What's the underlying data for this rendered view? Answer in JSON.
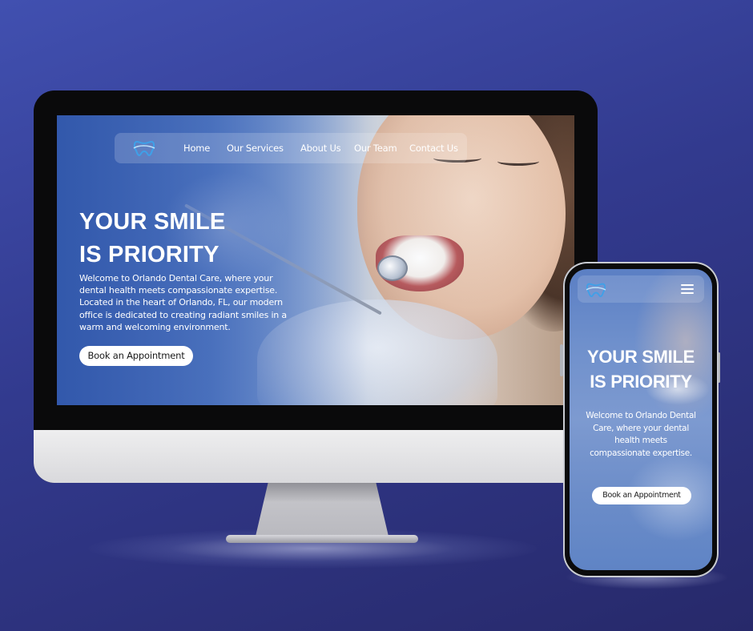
{
  "desktop": {
    "nav": {
      "items": [
        {
          "label": "Home"
        },
        {
          "label": "Our Services"
        },
        {
          "label": "About Us"
        },
        {
          "label": "Our Team"
        },
        {
          "label": "Contact Us"
        }
      ],
      "logo_icon": "tooth-logo-icon"
    },
    "hero": {
      "title_line1": "YOUR SMILE",
      "title_line2": "IS PRIORITY",
      "description": "Welcome to Orlando Dental Care, where your dental health meets compassionate expertise. Located in the heart of Orlando, FL, our modern office is dedicated to creating radiant smiles in a warm and welcoming environment.",
      "cta_label": "Book an Appointment"
    }
  },
  "mobile": {
    "nav": {
      "logo_icon": "tooth-logo-icon",
      "menu_icon": "hamburger-menu-icon"
    },
    "hero": {
      "title_line1": "YOUR SMILE",
      "title_line2": "IS PRIORITY",
      "description": "Welcome to Orlando Dental Care, where your dental health meets compassionate expertise.",
      "cta_label": "Book an Appointment"
    }
  },
  "colors": {
    "background": "#3a44a0",
    "accent_blue": "#3f66b5",
    "logo_blue": "#3fa0e8",
    "button_bg": "#ffffff",
    "text": "#ffffff"
  }
}
